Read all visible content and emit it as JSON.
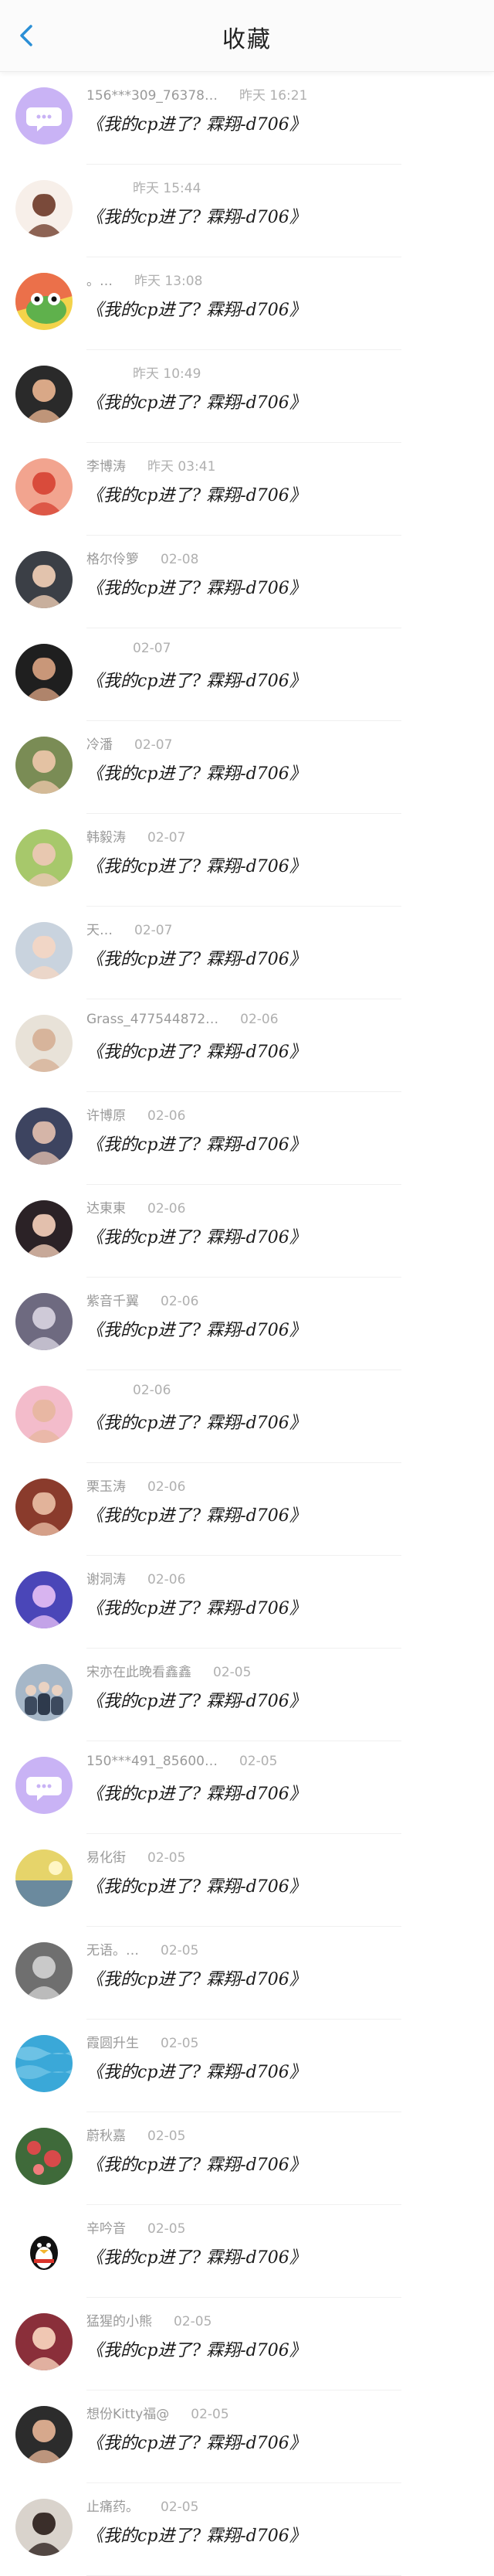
{
  "header": {
    "title": "收藏",
    "back_icon": "chevron-left-icon",
    "accent": "#2b8fd6"
  },
  "items": [
    {
      "name": "156***309_76378…",
      "time": "昨天 16:21",
      "message": "《我的cp进了? 霖翔-d706》",
      "avatar": "chat-bubble-avatar",
      "colors": [
        "#c9b3f5",
        "#ffffff"
      ]
    },
    {
      "name": "",
      "time": "昨天 15:44",
      "message": "《我的cp进了? 霖翔-d706》",
      "avatar": "cartoon-girl-avatar",
      "colors": [
        "#f7efe9",
        "#7a4a3a"
      ]
    },
    {
      "name": "。…",
      "time": "昨天 13:08",
      "message": "《我的cp进了? 霖翔-d706》",
      "avatar": "frog-avatar",
      "colors": [
        "#f3d34a",
        "#5fb14c"
      ]
    },
    {
      "name": "",
      "time": "昨天 10:49",
      "message": "《我的cp进了? 霖翔-d706》",
      "avatar": "person-dark-avatar",
      "colors": [
        "#2a2a2a",
        "#d9a887"
      ]
    },
    {
      "name": "李博涛",
      "time": "昨天 03:41",
      "message": "《我的cp进了? 霖翔-d706》",
      "avatar": "cartoon-red-avatar",
      "colors": [
        "#f2a48f",
        "#d94b3b"
      ]
    },
    {
      "name": "格尔伶箩",
      "time": "02-08",
      "message": "《我的cp进了? 霖翔-d706》",
      "avatar": "person-avatar",
      "colors": [
        "#3b3f46",
        "#e2c3ad"
      ]
    },
    {
      "name": "",
      "time": "02-07",
      "message": "《我的cp进了? 霖翔-d706》",
      "avatar": "person-dark-avatar",
      "colors": [
        "#1f1f1f",
        "#c99779"
      ]
    },
    {
      "name": "冷潘",
      "time": "02-07",
      "message": "《我的cp进了? 霖翔-d706》",
      "avatar": "person-outdoor-avatar",
      "colors": [
        "#7a8c55",
        "#e4c2a3"
      ]
    },
    {
      "name": "韩毅涛",
      "time": "02-07",
      "message": "《我的cp进了? 霖翔-d706》",
      "avatar": "person-green-avatar",
      "colors": [
        "#a7c86b",
        "#e8c8b0"
      ]
    },
    {
      "name": "天…",
      "time": "02-07",
      "message": "《我的cp进了? 霖翔-d706》",
      "avatar": "baby-avatar",
      "colors": [
        "#c9d3de",
        "#f1d6c6"
      ]
    },
    {
      "name": "Grass_477544872…",
      "time": "02-06",
      "message": "《我的cp进了? 霖翔-d706》",
      "avatar": "person-light-avatar",
      "colors": [
        "#e8e2d8",
        "#d7b49b"
      ]
    },
    {
      "name": "许博原",
      "time": "02-06",
      "message": "《我的cp进了? 霖翔-d706》",
      "avatar": "person-night-avatar",
      "colors": [
        "#3d4460",
        "#d5b5a8"
      ]
    },
    {
      "name": "达東東",
      "time": "02-06",
      "message": "《我的cp进了? 霖翔-d706》",
      "avatar": "person-dark-hair-avatar",
      "colors": [
        "#2b2226",
        "#e3c0ad"
      ]
    },
    {
      "name": "紫音千翼",
      "time": "02-06",
      "message": "《我的cp进了? 霖翔-d706》",
      "avatar": "anime-avatar",
      "colors": [
        "#6e6a80",
        "#cfcad8"
      ]
    },
    {
      "name": "",
      "time": "02-06",
      "message": "《我的cp进了? 霖翔-d706》",
      "avatar": "pink-person-avatar",
      "colors": [
        "#f3bccb",
        "#e8b7a3"
      ]
    },
    {
      "name": "栗玉涛",
      "time": "02-06",
      "message": "《我的cp进了? 霖翔-d706》",
      "avatar": "person-red-avatar",
      "colors": [
        "#8a3b2c",
        "#e2b39a"
      ]
    },
    {
      "name": "谢洞涛",
      "time": "02-06",
      "message": "《我的cp进了? 霖翔-d706》",
      "avatar": "concert-avatar",
      "colors": [
        "#4a46b8",
        "#d8b4f0"
      ]
    },
    {
      "name": "宋亦在此晚看鑫鑫",
      "time": "02-05",
      "message": "《我的cp进了? 霖翔-d706》",
      "avatar": "group-avatar",
      "colors": [
        "#a6b7c8",
        "#e9d2c2"
      ]
    },
    {
      "name": "150***491_85600…",
      "time": "02-05",
      "message": "《我的cp进了? 霖翔-d706》",
      "avatar": "chat-bubble-avatar",
      "colors": [
        "#c9b3f5",
        "#ffffff"
      ]
    },
    {
      "name": "易化街",
      "time": "02-05",
      "message": "《我的cp进了? 霖翔-d706》",
      "avatar": "landscape-avatar",
      "colors": [
        "#e6d46a",
        "#6b8a9e"
      ]
    },
    {
      "name": "无语。…",
      "time": "02-05",
      "message": "《我的cp进了? 霖翔-d706》",
      "avatar": "gray-person-avatar",
      "colors": [
        "#6f6f6f",
        "#c9c9c9"
      ]
    },
    {
      "name": "霞圆升生",
      "time": "02-05",
      "message": "《我的cp进了? 霖翔-d706》",
      "avatar": "water-avatar",
      "colors": [
        "#3aa8d8",
        "#8fd3ee"
      ]
    },
    {
      "name": "蔚秋嘉",
      "time": "02-05",
      "message": "《我的cp进了? 霖翔-d706》",
      "avatar": "flowers-avatar",
      "colors": [
        "#3f6a3a",
        "#d84a4a"
      ]
    },
    {
      "name": "辛吟音",
      "time": "02-05",
      "message": "《我的cp进了? 霖翔-d706》",
      "avatar": "penguin-avatar",
      "colors": [
        "#ffffff",
        "#111111"
      ]
    },
    {
      "name": "猛猩的小熊",
      "time": "02-05",
      "message": "《我的cp进了? 霖翔-d706》",
      "avatar": "person-bright-avatar",
      "colors": [
        "#8a2f3a",
        "#f0c7b3"
      ]
    },
    {
      "name": "想份Kitty福@",
      "time": "02-05",
      "message": "《我的cp进了? 霖翔-d706》",
      "avatar": "person-dim-avatar",
      "colors": [
        "#2c2c2c",
        "#d6a88c"
      ]
    },
    {
      "name": "止痛药。",
      "time": "02-05",
      "message": "《我的cp进了? 霖翔-d706》",
      "avatar": "person-soft-avatar",
      "colors": [
        "#d9d3cc",
        "#3a2e2a"
      ]
    }
  ]
}
